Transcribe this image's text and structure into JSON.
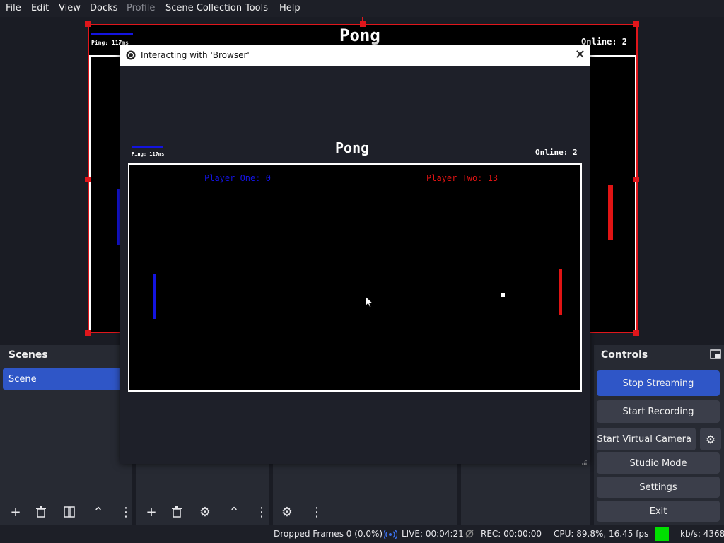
{
  "menu": [
    "File",
    "Edit",
    "View",
    "Docks",
    "Profile",
    "Scene Collection",
    "Tools",
    "Help"
  ],
  "preview": {
    "ping": "Ping: 117ms",
    "title": "Pong",
    "online": "Online: 2"
  },
  "dialog": {
    "title": "Interacting with 'Browser'",
    "pong_title": "Pong",
    "ping": "Ping: 117ms",
    "online": "Online: 2",
    "player_one": "Player One: 0",
    "player_two": "Player Two: 13"
  },
  "scenes": {
    "title": "Scenes",
    "items": [
      "Scene"
    ]
  },
  "controls": {
    "title": "Controls",
    "stop_streaming": "Stop Streaming",
    "start_recording": "Start Recording",
    "start_virtual_camera": "Start Virtual Camera",
    "studio_mode": "Studio Mode",
    "settings": "Settings",
    "exit": "Exit"
  },
  "status": {
    "dropped_frames": "Dropped Frames 0 (0.0%)",
    "live": "LIVE: 00:04:21",
    "rec": "REC: 00:00:00",
    "cpu": "CPU: 89.8%, 16.45 fps",
    "kbs": "kb/s: 4368",
    "health_color": "#00e000"
  },
  "colors": {
    "accent": "#2f56c7",
    "selection": "#e0161b",
    "player_one": "#1414e0",
    "player_two": "#e01414"
  }
}
